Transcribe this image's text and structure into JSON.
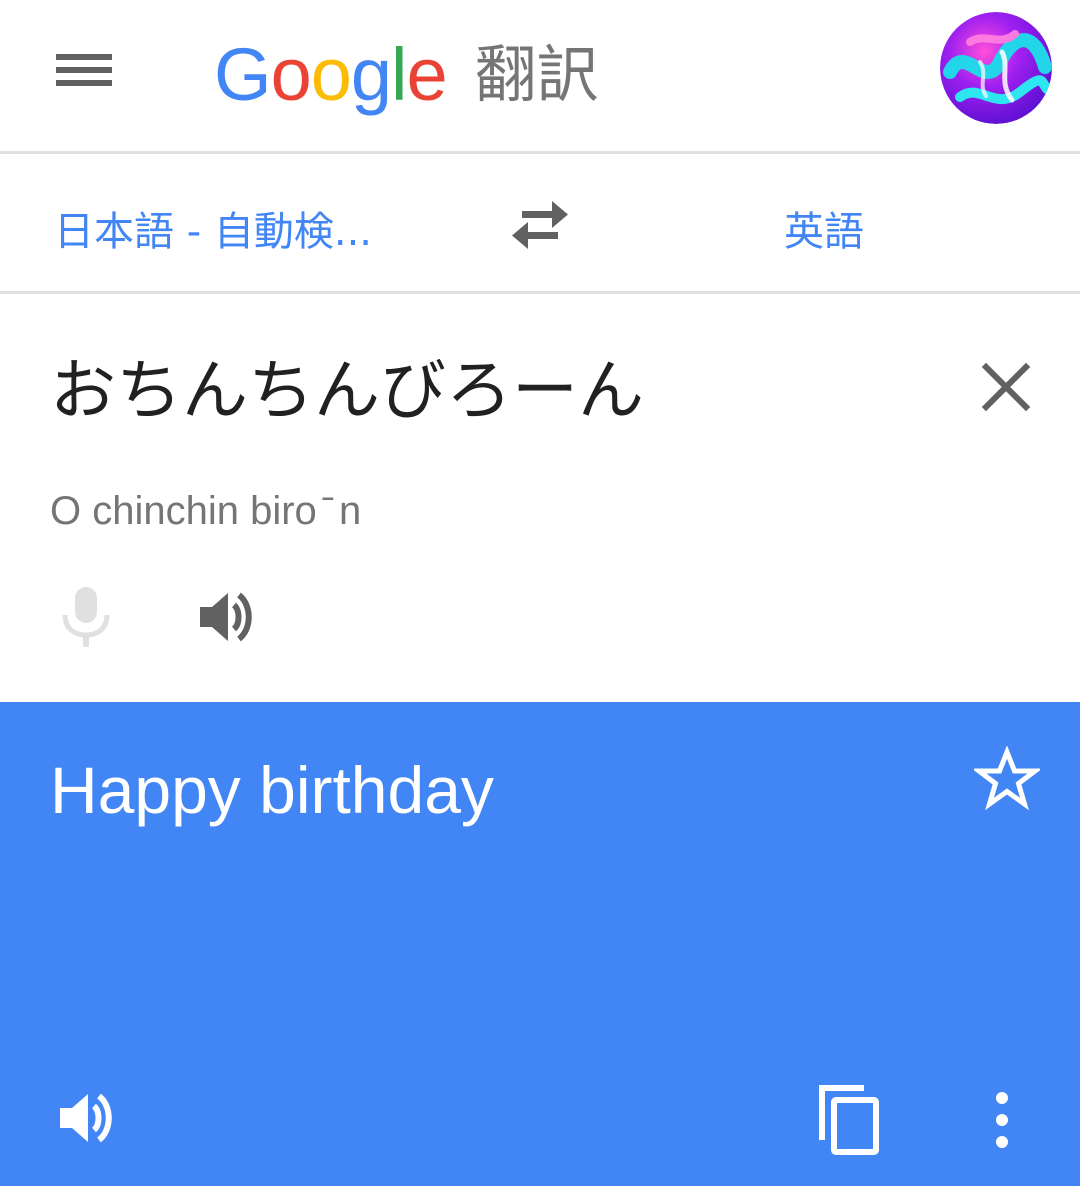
{
  "header": {
    "menu_icon": "hamburger-menu-icon",
    "logo_letters": [
      {
        "char": "G",
        "color": "#4285f4"
      },
      {
        "char": "o",
        "color": "#ea4335"
      },
      {
        "char": "o",
        "color": "#fbbc05"
      },
      {
        "char": "g",
        "color": "#4285f4"
      },
      {
        "char": "l",
        "color": "#34a853"
      },
      {
        "char": "e",
        "color": "#ea4335"
      }
    ],
    "product_name": "翻訳",
    "avatar_icon": "user-avatar"
  },
  "language_bar": {
    "source_language": "日本語 - 自動検...",
    "swap_icon": "swap-arrows-icon",
    "target_language": "英語",
    "accent_color": "#4285f4"
  },
  "input": {
    "text": "おちんちんびろーん",
    "romanization": "O chinchin biro  ̄ n",
    "clear_icon": "close-icon",
    "mic_icon": "microphone-icon",
    "speaker_icon": "speaker-icon"
  },
  "result": {
    "text": "Happy birthday",
    "background_color": "#4285f4",
    "star_icon": "star-outline-icon",
    "speaker_icon": "speaker-icon",
    "copy_icon": "copy-icon",
    "more_icon": "more-vert-icon"
  }
}
